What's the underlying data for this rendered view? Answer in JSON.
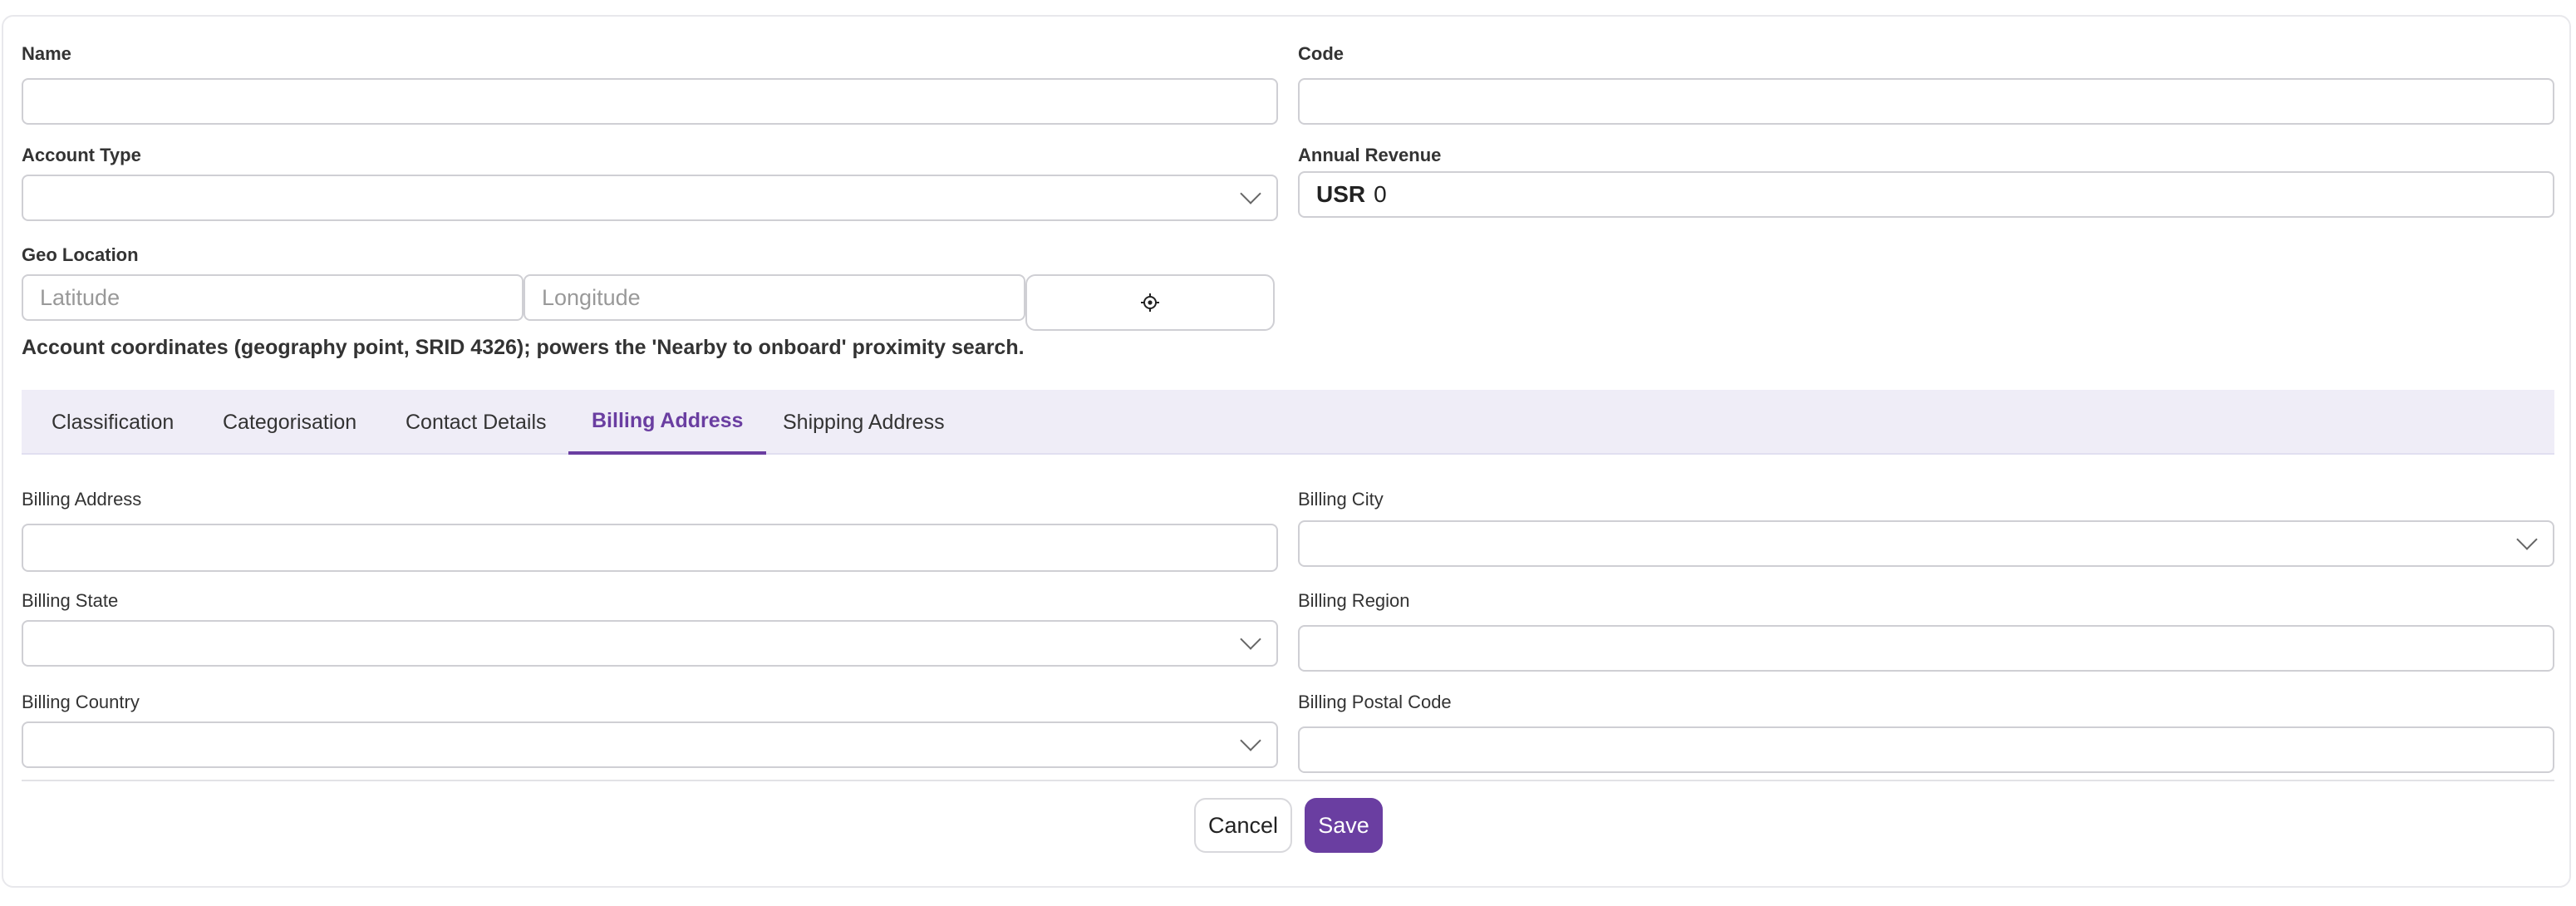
{
  "form": {
    "name_label": "Name",
    "code_label": "Code",
    "account_type_label": "Account Type",
    "annual_revenue_label": "Annual Revenue",
    "annual_revenue_currency": "USR",
    "annual_revenue_value": "0",
    "geo_location_label": "Geo Location",
    "latitude_placeholder": "Latitude",
    "longitude_placeholder": "Longitude",
    "geo_hint": "Account coordinates (geography point, SRID 4326); powers the 'Nearby to onboard' proximity search."
  },
  "tabs": [
    {
      "label": "Classification"
    },
    {
      "label": "Categorisation"
    },
    {
      "label": "Contact Details"
    },
    {
      "label": "Billing Address",
      "active": true
    },
    {
      "label": "Shipping Address"
    }
  ],
  "billing": {
    "address_label": "Billing Address",
    "city_label": "Billing City",
    "state_label": "Billing State",
    "region_label": "Billing Region",
    "country_label": "Billing Country",
    "postal_code_label": "Billing Postal Code"
  },
  "actions": {
    "cancel_label": "Cancel",
    "save_label": "Save"
  },
  "colors": {
    "accent": "#6a3ea1",
    "tab_bar_bg": "#efedf7"
  },
  "icons": {
    "locate": "crosshair-icon",
    "dropdown": "chevron-down-icon"
  }
}
